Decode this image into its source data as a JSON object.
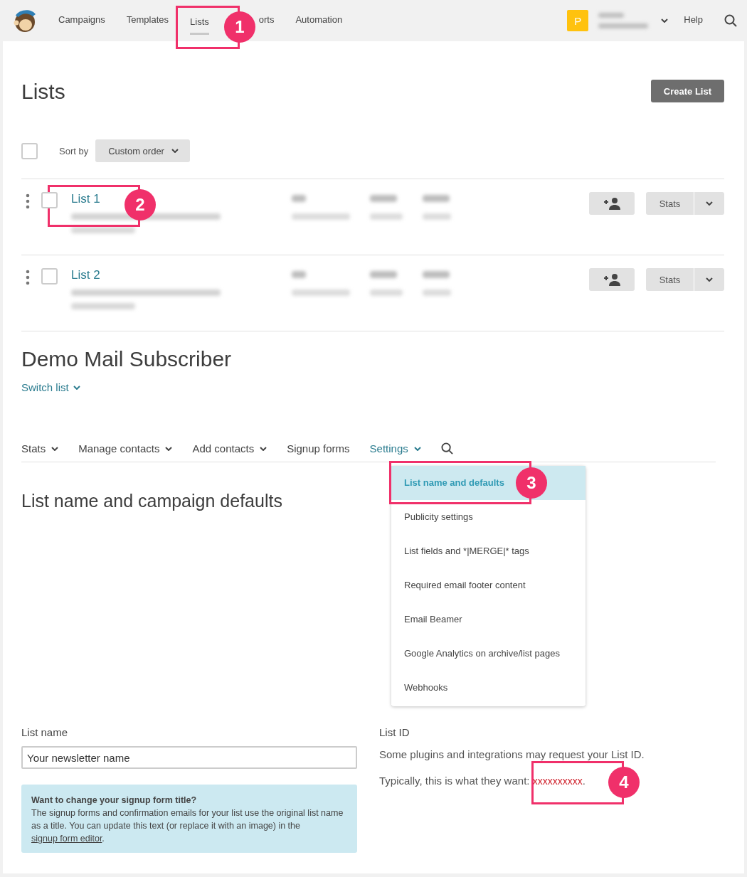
{
  "nav": {
    "items": [
      {
        "label": "Campaigns",
        "selected": false
      },
      {
        "label": "Templates",
        "selected": false
      },
      {
        "label": "Lists",
        "selected": true
      },
      {
        "label": "orts",
        "selected": false,
        "covered_start": true
      },
      {
        "label": "Automation",
        "selected": false
      }
    ],
    "avatar": "P",
    "help": "Help"
  },
  "page_title": "Lists",
  "create_button": "Create List",
  "sort": {
    "checked": false,
    "label": "Sort by",
    "value": "Custom order"
  },
  "lists": [
    {
      "name": "List 1",
      "checked": false,
      "stats_button": "Stats"
    },
    {
      "name": "List 2",
      "checked": false,
      "stats_button": "Stats"
    }
  ],
  "list_title": "Demo Mail Subscriber",
  "switch_list": "Switch list",
  "tabs": [
    {
      "label": "Stats",
      "dropdown": true,
      "selected": false
    },
    {
      "label": "Manage contacts",
      "dropdown": true,
      "selected": false
    },
    {
      "label": "Add contacts",
      "dropdown": true,
      "selected": false
    },
    {
      "label": "Signup forms",
      "dropdown": false,
      "selected": false
    },
    {
      "label": "Settings",
      "dropdown": true,
      "selected": true
    }
  ],
  "menu": [
    {
      "label": "List name and defaults",
      "selected": true
    },
    {
      "label": "Publicity settings",
      "selected": false
    },
    {
      "label": "List fields and *|MERGE|* tags",
      "selected": false
    },
    {
      "label": "Required email footer content",
      "selected": false
    },
    {
      "label": "Email Beamer",
      "selected": false
    },
    {
      "label": "Google Analytics on archive/list pages",
      "selected": false
    },
    {
      "label": "Webhooks",
      "selected": false
    }
  ],
  "section_title": "List name and campaign defaults",
  "form": {
    "label": "List name",
    "value": "Your newsletter name"
  },
  "notice": {
    "title": "Want to change your signup form title?",
    "text": "The signup forms and confirmation emails for your list use the original list name as a title. You can update this text (or replace it with an image) in the ",
    "link": "signup form editor",
    "end": "."
  },
  "list_id": {
    "label": "List ID",
    "text": "Some plugins and integrations may request your List ID.",
    "prefix": "Typically, this is what they want: ",
    "id": "xxxxxxxxxx",
    "suffix": "."
  },
  "annotations": [
    "1",
    "2",
    "3",
    "4"
  ]
}
